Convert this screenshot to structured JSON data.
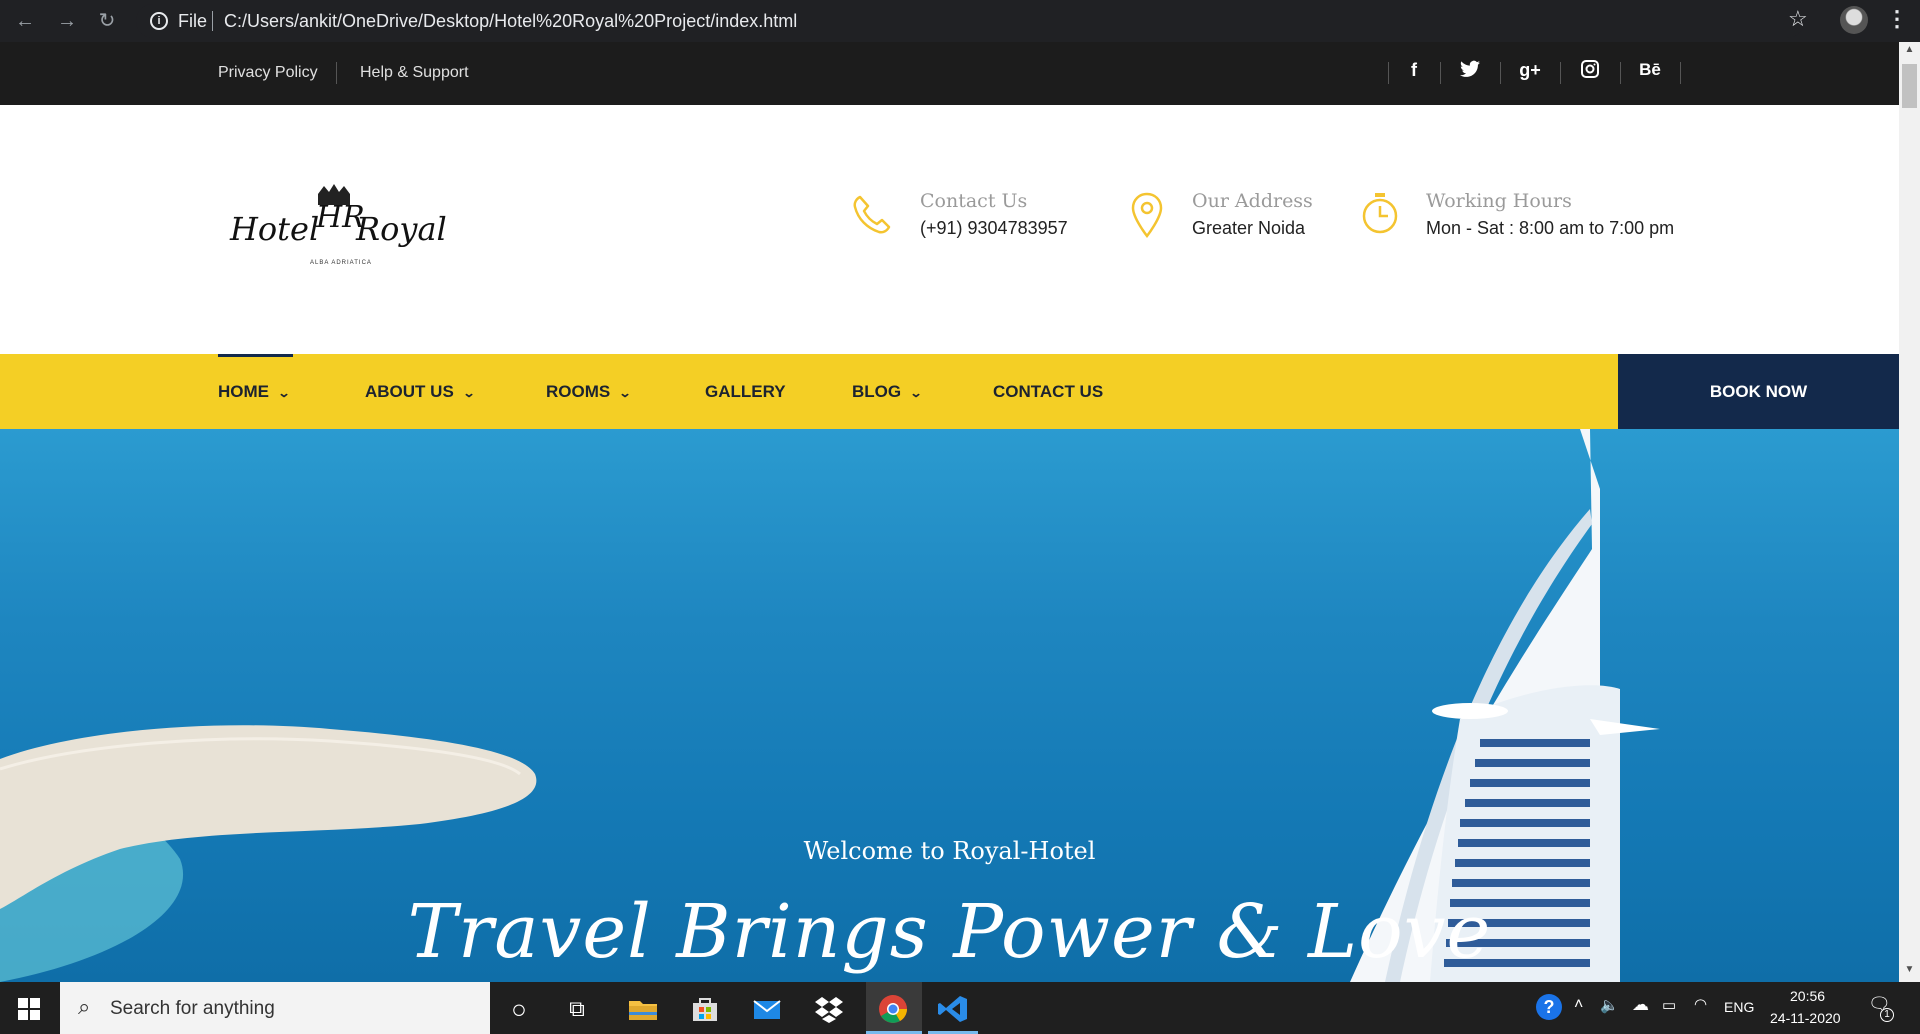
{
  "browser": {
    "file_label": "File",
    "url": "C:/Users/ankit/OneDrive/Desktop/Hotel%20Royal%20Project/index.html"
  },
  "topbar": {
    "links": [
      "Privacy Policy",
      "Help & Support"
    ],
    "social": [
      {
        "icon": "facebook-icon",
        "glyph": "f"
      },
      {
        "icon": "twitter-icon",
        "glyph": "🐦"
      },
      {
        "icon": "google-plus-icon",
        "glyph": "g+"
      },
      {
        "icon": "instagram-icon",
        "glyph": "◙"
      },
      {
        "icon": "behance-icon",
        "glyph": "Bē"
      }
    ]
  },
  "logo": {
    "text_left": "Hotel",
    "monogram": "HR",
    "text_right": "Royal",
    "tagline": "ALBA ADRIATICA"
  },
  "header_info": [
    {
      "label": "Contact Us",
      "value": "(+91) 9304783957",
      "icon": "phone-icon"
    },
    {
      "label": "Our Address",
      "value": "Greater Noida",
      "icon": "location-pin-icon"
    },
    {
      "label": "Working Hours",
      "value": "Mon - Sat : 8:00 am to 7:00 pm",
      "icon": "clock-icon"
    }
  ],
  "nav": {
    "items": [
      {
        "label": "HOME",
        "dropdown": true
      },
      {
        "label": "ABOUT US",
        "dropdown": true
      },
      {
        "label": "ROOMS",
        "dropdown": true
      },
      {
        "label": "GALLERY",
        "dropdown": false
      },
      {
        "label": "BLOG",
        "dropdown": true
      },
      {
        "label": "CONTACT US",
        "dropdown": false
      }
    ],
    "book_now": "BOOK NOW"
  },
  "hero": {
    "welcome": "Welcome to Royal-Hotel",
    "tagline": "Travel Brings Power & Love"
  },
  "taskbar": {
    "search_placeholder": "Search for anything",
    "language": "ENG",
    "time": "20:56",
    "date": "24-11-2020",
    "notification_count": "1"
  },
  "colors": {
    "nav_yellow": "#f4cf25",
    "navy": "#13294b",
    "accent_icon": "#f4c430"
  }
}
